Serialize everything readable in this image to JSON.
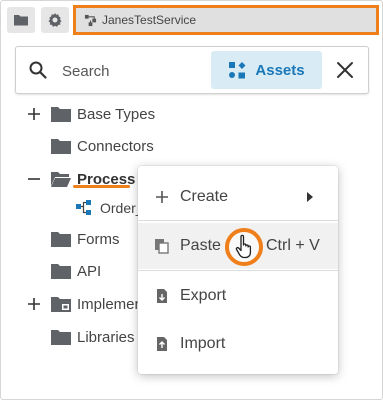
{
  "topbar": {
    "service_name": "JanesTestService"
  },
  "search": {
    "placeholder": "Search",
    "assets_label": "Assets"
  },
  "tree": {
    "items": [
      {
        "label": "Base Types",
        "toggle": "+"
      },
      {
        "label": "Connectors",
        "toggle": ""
      },
      {
        "label": "Process",
        "toggle": "-"
      },
      {
        "label": "Order_",
        "toggle": ""
      },
      {
        "label": "Forms",
        "toggle": ""
      },
      {
        "label": "API",
        "toggle": ""
      },
      {
        "label": "Implemen",
        "toggle": "+"
      },
      {
        "label": "Libraries",
        "toggle": ""
      }
    ]
  },
  "context_menu": {
    "create": "Create",
    "paste": "Paste",
    "paste_shortcut": "Ctrl + V",
    "export": "Export",
    "import": "Import"
  },
  "colors": {
    "accent_orange": "#ef7f1a",
    "assets_blue": "#1a78b8",
    "folder_gray": "#5f6368"
  }
}
